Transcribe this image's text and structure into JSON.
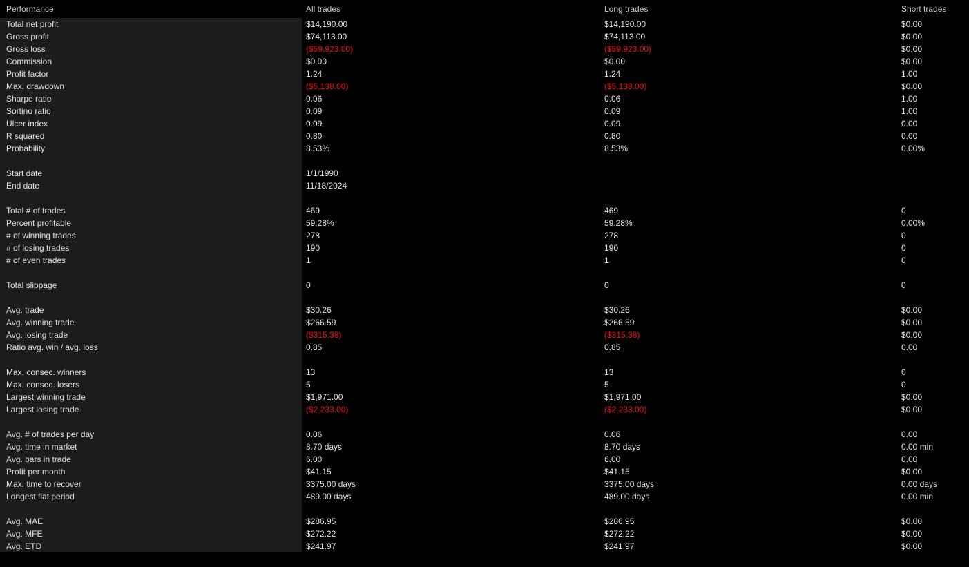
{
  "report": {
    "title": "Performance",
    "columns": [
      "Performance",
      "All trades",
      "Long trades",
      "Short trades"
    ],
    "colors": {
      "background": "#000000",
      "panel": "#1c1c1c",
      "header_text": "#c3cdda",
      "value_text": "#e2e2e2",
      "negative_text": "#ee1111"
    }
  },
  "groups": [
    {
      "rows": [
        {
          "label": "Total net profit",
          "all": "$14,190.00",
          "long": "$14,190.00",
          "short": "$0.00",
          "neg": [
            false,
            false,
            false
          ]
        },
        {
          "label": "Gross profit",
          "all": "$74,113.00",
          "long": "$74,113.00",
          "short": "$0.00",
          "neg": [
            false,
            false,
            false
          ]
        },
        {
          "label": "Gross loss",
          "all": "($59,923.00)",
          "long": "($59,923.00)",
          "short": "$0.00",
          "neg": [
            true,
            true,
            false
          ]
        },
        {
          "label": "Commission",
          "all": "$0.00",
          "long": "$0.00",
          "short": "$0.00",
          "neg": [
            false,
            false,
            false
          ]
        },
        {
          "label": "Profit factor",
          "all": "1.24",
          "long": "1.24",
          "short": "1.00",
          "neg": [
            false,
            false,
            false
          ]
        },
        {
          "label": "Max. drawdown",
          "all": "($5,138.00)",
          "long": "($5,138.00)",
          "short": "$0.00",
          "neg": [
            true,
            true,
            false
          ]
        },
        {
          "label": "Sharpe ratio",
          "all": "0.06",
          "long": "0.06",
          "short": "1.00",
          "neg": [
            false,
            false,
            false
          ]
        },
        {
          "label": "Sortino ratio",
          "all": "0.09",
          "long": "0.09",
          "short": "1.00",
          "neg": [
            false,
            false,
            false
          ]
        },
        {
          "label": "Ulcer index",
          "all": "0.09",
          "long": "0.09",
          "short": "0.00",
          "neg": [
            false,
            false,
            false
          ]
        },
        {
          "label": "R squared",
          "all": "0.80",
          "long": "0.80",
          "short": "0.00",
          "neg": [
            false,
            false,
            false
          ]
        },
        {
          "label": "Probability",
          "all": "8.53%",
          "long": "8.53%",
          "short": "0.00%",
          "neg": [
            false,
            false,
            false
          ]
        }
      ]
    },
    {
      "rows": [
        {
          "label": "Start date",
          "all": "1/1/1990",
          "long": "",
          "short": "",
          "neg": [
            false,
            false,
            false
          ]
        },
        {
          "label": "End date",
          "all": "11/18/2024",
          "long": "",
          "short": "",
          "neg": [
            false,
            false,
            false
          ]
        }
      ]
    },
    {
      "rows": [
        {
          "label": "Total # of trades",
          "all": "469",
          "long": "469",
          "short": "0",
          "neg": [
            false,
            false,
            false
          ]
        },
        {
          "label": "Percent profitable",
          "all": "59.28%",
          "long": "59.28%",
          "short": "0.00%",
          "neg": [
            false,
            false,
            false
          ]
        },
        {
          "label": "# of winning trades",
          "all": "278",
          "long": "278",
          "short": "0",
          "neg": [
            false,
            false,
            false
          ]
        },
        {
          "label": "# of losing trades",
          "all": "190",
          "long": "190",
          "short": "0",
          "neg": [
            false,
            false,
            false
          ]
        },
        {
          "label": "# of even trades",
          "all": "1",
          "long": "1",
          "short": "0",
          "neg": [
            false,
            false,
            false
          ]
        }
      ]
    },
    {
      "rows": [
        {
          "label": "Total slippage",
          "all": "0",
          "long": "0",
          "short": "0",
          "neg": [
            false,
            false,
            false
          ]
        }
      ]
    },
    {
      "rows": [
        {
          "label": "Avg. trade",
          "all": "$30.26",
          "long": "$30.26",
          "short": "$0.00",
          "neg": [
            false,
            false,
            false
          ]
        },
        {
          "label": "Avg. winning trade",
          "all": "$266.59",
          "long": "$266.59",
          "short": "$0.00",
          "neg": [
            false,
            false,
            false
          ]
        },
        {
          "label": "Avg. losing trade",
          "all": "($315.38)",
          "long": "($315.38)",
          "short": "$0.00",
          "neg": [
            true,
            true,
            false
          ]
        },
        {
          "label": "Ratio avg. win / avg. loss",
          "all": "0.85",
          "long": "0.85",
          "short": "0.00",
          "neg": [
            false,
            false,
            false
          ]
        }
      ]
    },
    {
      "rows": [
        {
          "label": "Max. consec. winners",
          "all": "13",
          "long": "13",
          "short": "0",
          "neg": [
            false,
            false,
            false
          ]
        },
        {
          "label": "Max. consec. losers",
          "all": "5",
          "long": "5",
          "short": "0",
          "neg": [
            false,
            false,
            false
          ]
        },
        {
          "label": "Largest winning trade",
          "all": "$1,971.00",
          "long": "$1,971.00",
          "short": "$0.00",
          "neg": [
            false,
            false,
            false
          ]
        },
        {
          "label": "Largest losing trade",
          "all": "($2,233.00)",
          "long": "($2,233.00)",
          "short": "$0.00",
          "neg": [
            true,
            true,
            false
          ]
        }
      ]
    },
    {
      "rows": [
        {
          "label": "Avg. # of trades per day",
          "all": "0.06",
          "long": "0.06",
          "short": "0.00",
          "neg": [
            false,
            false,
            false
          ]
        },
        {
          "label": "Avg. time in market",
          "all": "8.70 days",
          "long": "8.70 days",
          "short": "0.00 min",
          "neg": [
            false,
            false,
            false
          ]
        },
        {
          "label": "Avg. bars in trade",
          "all": "6.00",
          "long": "6.00",
          "short": "0.00",
          "neg": [
            false,
            false,
            false
          ]
        },
        {
          "label": "Profit per month",
          "all": "$41.15",
          "long": "$41.15",
          "short": "$0.00",
          "neg": [
            false,
            false,
            false
          ]
        },
        {
          "label": "Max. time to recover",
          "all": "3375.00 days",
          "long": "3375.00 days",
          "short": "0.00 days",
          "neg": [
            false,
            false,
            false
          ]
        },
        {
          "label": "Longest flat period",
          "all": "489.00 days",
          "long": "489.00 days",
          "short": "0.00 min",
          "neg": [
            false,
            false,
            false
          ]
        }
      ]
    },
    {
      "rows": [
        {
          "label": "Avg. MAE",
          "all": "$286.95",
          "long": "$286.95",
          "short": "$0.00",
          "neg": [
            false,
            false,
            false
          ]
        },
        {
          "label": "Avg. MFE",
          "all": "$272.22",
          "long": "$272.22",
          "short": "$0.00",
          "neg": [
            false,
            false,
            false
          ]
        },
        {
          "label": "Avg. ETD",
          "all": "$241.97",
          "long": "$241.97",
          "short": "$0.00",
          "neg": [
            false,
            false,
            false
          ]
        }
      ]
    }
  ]
}
